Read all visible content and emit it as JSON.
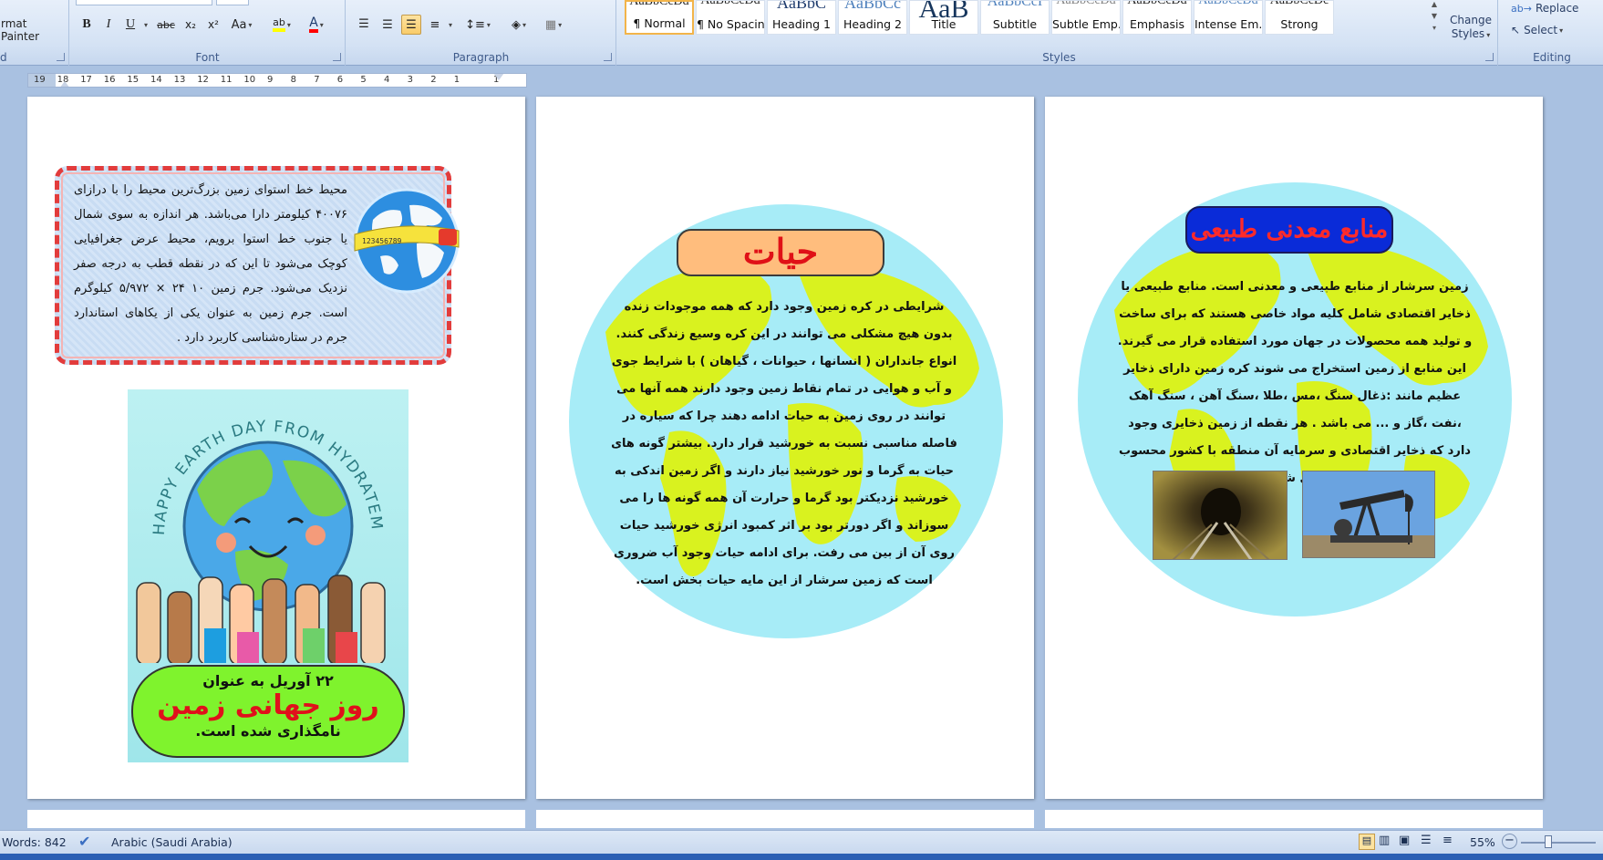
{
  "ribbon": {
    "clipboard": {
      "format_painter": "rmat Painter",
      "label": "d"
    },
    "font": {
      "label": "Font",
      "bold": "B",
      "italic": "I",
      "underline": "U",
      "strike": "abc",
      "subscript": "x₂",
      "superscript": "x²",
      "change_case": "Aa",
      "highlight_color": "#ffff00",
      "font_color": "#ff0000"
    },
    "paragraph": {
      "label": "Paragraph"
    },
    "styles": {
      "label": "Styles",
      "items": [
        {
          "preview": "AaBbCcDd",
          "name": "¶ Normal"
        },
        {
          "preview": "AaBbCcDd",
          "name": "¶ No Spacing"
        },
        {
          "preview": "AaBbC",
          "name": "Heading 1"
        },
        {
          "preview": "AaBbCc",
          "name": "Heading 2"
        },
        {
          "preview": "AaB",
          "name": "Title"
        },
        {
          "preview": "AaBbCcI",
          "name": "Subtitle"
        },
        {
          "preview": "AaBbCcDd",
          "name": "Subtle Emp..."
        },
        {
          "preview": "AaBbCcDd",
          "name": "Emphasis"
        },
        {
          "preview": "AaBbCcDd",
          "name": "Intense Em..."
        },
        {
          "preview": "AaBbCcDc",
          "name": "Strong"
        }
      ],
      "change_styles_line1": "Change",
      "change_styles_line2": "Styles"
    },
    "editing": {
      "label": "Editing",
      "replace": "Replace",
      "select": "Select"
    }
  },
  "ruler": {
    "ticks": [
      "19",
      "18",
      "17",
      "16",
      "15",
      "14",
      "13",
      "12",
      "11",
      "10",
      "9",
      "8",
      "7",
      "6",
      "5",
      "4",
      "3",
      "2",
      "1",
      "1"
    ]
  },
  "page1": {
    "info_text": "محیط خط استوای زمین بزرگ‌ترین محیط را با درازای ۴۰۰۷۶ کیلومتر دارا می‌باشد. هر اندازه به سوی شمال یا جنوب خط استوا برویم، محیط عرض جغرافیایی کوچک می‌شود تا این که در نقطه قطب به درجه صفر نزدیک می‌شود. جرم زمین ۱۰ ۲۴ × ۵/۹۷۲ کیلوگرم است. جرم زمین به عنوان یکی از یکاهای استاندارد جرم در ستاره‌شناسی کاربرد دارد .",
    "poster": {
      "arc_text": "HAPPY EARTH DAY FROM HYDRATEM8",
      "line1": "۲۲ آوریل به عنوان",
      "line2": "روز جهانی زمین",
      "line3": "نامگذاری شده است."
    }
  },
  "page2": {
    "title": "حیات",
    "text": "شرایطی در کره زمین وجود دارد که همه موجودات زنده بدون هیچ مشکلی می توانند در این کره وسیع زندگی کنند. انواع جانداران ( انسانها ، حیوانات ، گیاهان ) با شرایط جوی و آب و هوایی در تمام نقاط زمین وجود دارند همه آنها می توانند در روی زمین به حیات ادامه دهند چرا که سیاره در فاصله مناسبی نسبت به خورشید قرار دارد. بیشتر گونه های حیات به گرما و نور خورشید نیاز دارند و اگر زمین اندکی به خورشید نزدیکتر بود گرما و حرارت آن همه گونه ها را می سوزاند و اگر دورتر بود بر اثر کمبود انرژی خورشید حیات روی آن از بین می رفت. برای ادامه حیات وجود آب ضروری است که زمین سرشار از این مایه حیات بخش است."
  },
  "page3": {
    "title": "منابع معدنی طبیعی",
    "text": "زمین سرشار از منابع طبیعی و معدنی است. منابع طبیعی یا ذخایر اقتصادی شامل کلیه مواد خاصی هستند که برای ساخت و تولید همه محصولات در جهان مورد استفاده قرار می گیرند. این منابع از زمین استخراج می شوند کره زمین دارای ذخایر عظیم مانند :ذغال سنگ ،مس ،طلا ،سنگ آهن ، سنگ آهک ،نفت ،گاز و ... می باشد . هر نقطه از زمین ذخایری وجود دارد که ذخایر اقتصادی و سرمایه آن منطقه با کشور محسوب می شود"
  },
  "statusbar": {
    "words": "Words: 842",
    "language": "Arabic (Saudi Arabia)",
    "zoom": "55%"
  },
  "colors": {
    "ribbon_bg": "#d4e2f4",
    "workspace_bg": "#a9c1e1",
    "globe_water": "#a7ecf7",
    "globe_land": "#d9f21f",
    "hayat_title_bg": "#ffbd7d",
    "resources_title_bg": "#0a2bd8",
    "title_red": "#e01117",
    "poster_oval": "#7ff32d"
  }
}
